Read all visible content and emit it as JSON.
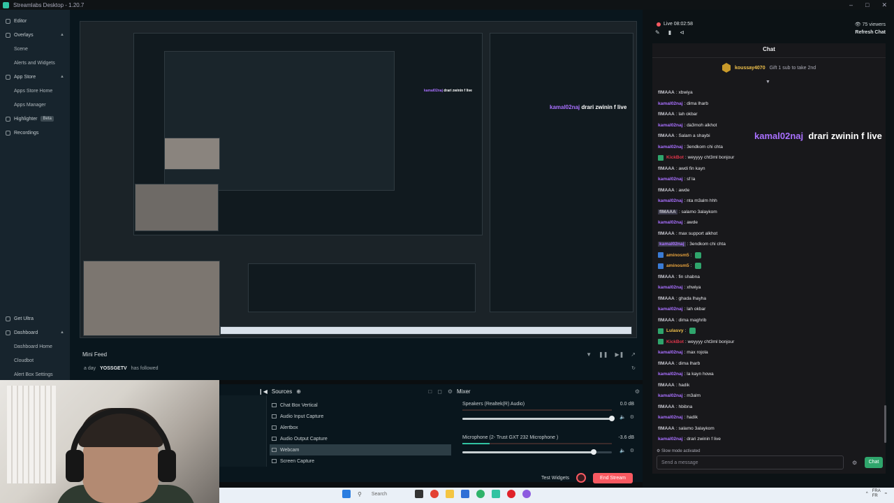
{
  "window": {
    "title": "Streamlabs Desktop - 1.20.7"
  },
  "sidebar": {
    "items": [
      {
        "label": "Editor",
        "level": 0,
        "icon": "editor-icon"
      },
      {
        "label": "Overlays",
        "level": 0,
        "icon": "overlays-icon",
        "expanded": true
      },
      {
        "label": "Scene",
        "level": 1
      },
      {
        "label": "Alerts and Widgets",
        "level": 1
      },
      {
        "label": "App Store",
        "level": 0,
        "icon": "store-icon",
        "expanded": true
      },
      {
        "label": "Apps Store Home",
        "level": 1
      },
      {
        "label": "Apps Manager",
        "level": 1
      },
      {
        "label": "Highlighter",
        "level": 0,
        "icon": "highlighter-icon",
        "badge": "Beta"
      },
      {
        "label": "Recordings",
        "level": 0,
        "icon": "recordings-icon"
      }
    ],
    "bottom": [
      {
        "label": "Get Ultra",
        "level": 0,
        "icon": "ultra-icon"
      },
      {
        "label": "Dashboard",
        "level": 0,
        "icon": "dashboard-icon",
        "expanded": true
      },
      {
        "label": "Dashboard Home",
        "level": 1
      },
      {
        "label": "Cloudbot",
        "level": 1
      },
      {
        "label": "Alert Box Settings",
        "level": 1
      }
    ]
  },
  "minifeed": {
    "title": "Mini Feed",
    "event": {
      "time": "a day",
      "user": "YOSSGETV",
      "action": "has followed"
    }
  },
  "sources": {
    "title": "Sources",
    "items": [
      "Chat Box Vertical",
      "Audio Input Capture",
      "Alertbox",
      "Audio Output Capture",
      "Webcam",
      "Screen Capture"
    ],
    "selected": 4
  },
  "mixer": {
    "title": "Mixer",
    "channels": [
      {
        "name": "Speakers (Realtek(R) Audio)",
        "db": "0.0 dB",
        "level": 1.0,
        "meter": 0.0
      },
      {
        "name": "Microphone (2- Trust GXT 232 Microphone )",
        "db": "-3.6 dB",
        "level": 0.88,
        "meter": 0.18
      }
    ]
  },
  "footer": {
    "test_widgets": "Test Widgets",
    "end_stream": "End Stream"
  },
  "stream": {
    "live": "Live 08:02:58",
    "viewers": "75 viewers",
    "refresh_chat": "Refresh Chat"
  },
  "chat": {
    "title": "Chat",
    "gift": {
      "user": "koussay4070",
      "text": "Gift 1 sub to take 2nd"
    },
    "overlay": {
      "user": "kamal02naj",
      "text": "drari zwinin f live"
    },
    "messages": [
      {
        "user": "flMAAA",
        "text": ": xbwiya",
        "color": "#c9c9d1"
      },
      {
        "user": "kamal02naj",
        "text": ": dima lharb",
        "color": "#a970ff"
      },
      {
        "user": "flMAAA",
        "text": ": lah okbar",
        "color": "#c9c9d1"
      },
      {
        "user": "kamal02naj",
        "text": ": da3moh alkhot",
        "color": "#a970ff"
      },
      {
        "user": "flMAAA",
        "text": ": Salam a shaybi",
        "color": "#c9c9d1"
      },
      {
        "user": "kamal02naj",
        "text": ": 3endkom chi chta",
        "color": "#a970ff"
      },
      {
        "user": "KickBot",
        "text": ": weyyyy cht3ml bonjour",
        "color": "#e0364b",
        "badge": true
      },
      {
        "user": "flMAAA",
        "text": ": awdi fin kayn",
        "color": "#c9c9d1"
      },
      {
        "user": "kamal02naj",
        "text": ": sf la",
        "color": "#a970ff"
      },
      {
        "user": "flMAAA",
        "text": ": awde",
        "color": "#c9c9d1"
      },
      {
        "user": "kamal02naj",
        "text": ": nta m3alm hhh",
        "color": "#a970ff"
      },
      {
        "user": "flMAAA",
        "text": ": salamo 3alaykom",
        "color": "#c9c9d1",
        "hl": true
      },
      {
        "user": "kamal02naj",
        "text": ": awde",
        "color": "#a970ff"
      },
      {
        "user": "flMAAA",
        "text": ": max support alkhot",
        "color": "#c9c9d1"
      },
      {
        "user": "kamal02naj",
        "text": ": 3endkom chi chta",
        "color": "#a970ff",
        "hl": true
      },
      {
        "user": "aminosm5",
        "text": ":",
        "color": "#e8a33d",
        "badge": true,
        "emote": true
      },
      {
        "user": "aminosm5",
        "text": ":",
        "color": "#e8a33d",
        "badge": true,
        "emote": true
      },
      {
        "user": "flMAAA",
        "text": ": fin shabna",
        "color": "#c9c9d1"
      },
      {
        "user": "kamal02naj",
        "text": ": xhwiya",
        "color": "#a970ff"
      },
      {
        "user": "flMAAA",
        "text": ": ghada lhayha",
        "color": "#c9c9d1"
      },
      {
        "user": "kamal02naj",
        "text": ": lah okbar",
        "color": "#a970ff"
      },
      {
        "user": "flMAAA",
        "text": ": dima maghrib",
        "color": "#c9c9d1"
      },
      {
        "user": "Lulasvy",
        "text": ":",
        "color": "#f0c14b",
        "badge": true,
        "emote": true
      },
      {
        "user": "KickBot",
        "text": ": weyyyy cht3ml bonjour",
        "color": "#e0364b",
        "badge": true
      },
      {
        "user": "kamal02naj",
        "text": ": max rojola",
        "color": "#a970ff"
      },
      {
        "user": "flMAAA",
        "text": ": dima lharb",
        "color": "#c9c9d1"
      },
      {
        "user": "kamal02naj",
        "text": ": la kayn howa",
        "color": "#a970ff"
      },
      {
        "user": "flMAAA",
        "text": ": hadik",
        "color": "#c9c9d1"
      },
      {
        "user": "kamal02naj",
        "text": ": m3alm",
        "color": "#a970ff"
      },
      {
        "user": "flMAAA",
        "text": ": hbibna",
        "color": "#c9c9d1"
      },
      {
        "user": "kamal02naj",
        "text": ": hadik",
        "color": "#a970ff"
      },
      {
        "user": "flMAAA",
        "text": ": salamo 3alaykom",
        "color": "#c9c9d1"
      },
      {
        "user": "kamal02naj",
        "text": ": drari zwinin f live",
        "color": "#a970ff"
      }
    ],
    "slow_mode": "Slow mode activated",
    "input_placeholder": "Send a message",
    "send_label": "Chat"
  },
  "taskbar": {
    "search": "Search",
    "lang": "FRA\nFR"
  }
}
